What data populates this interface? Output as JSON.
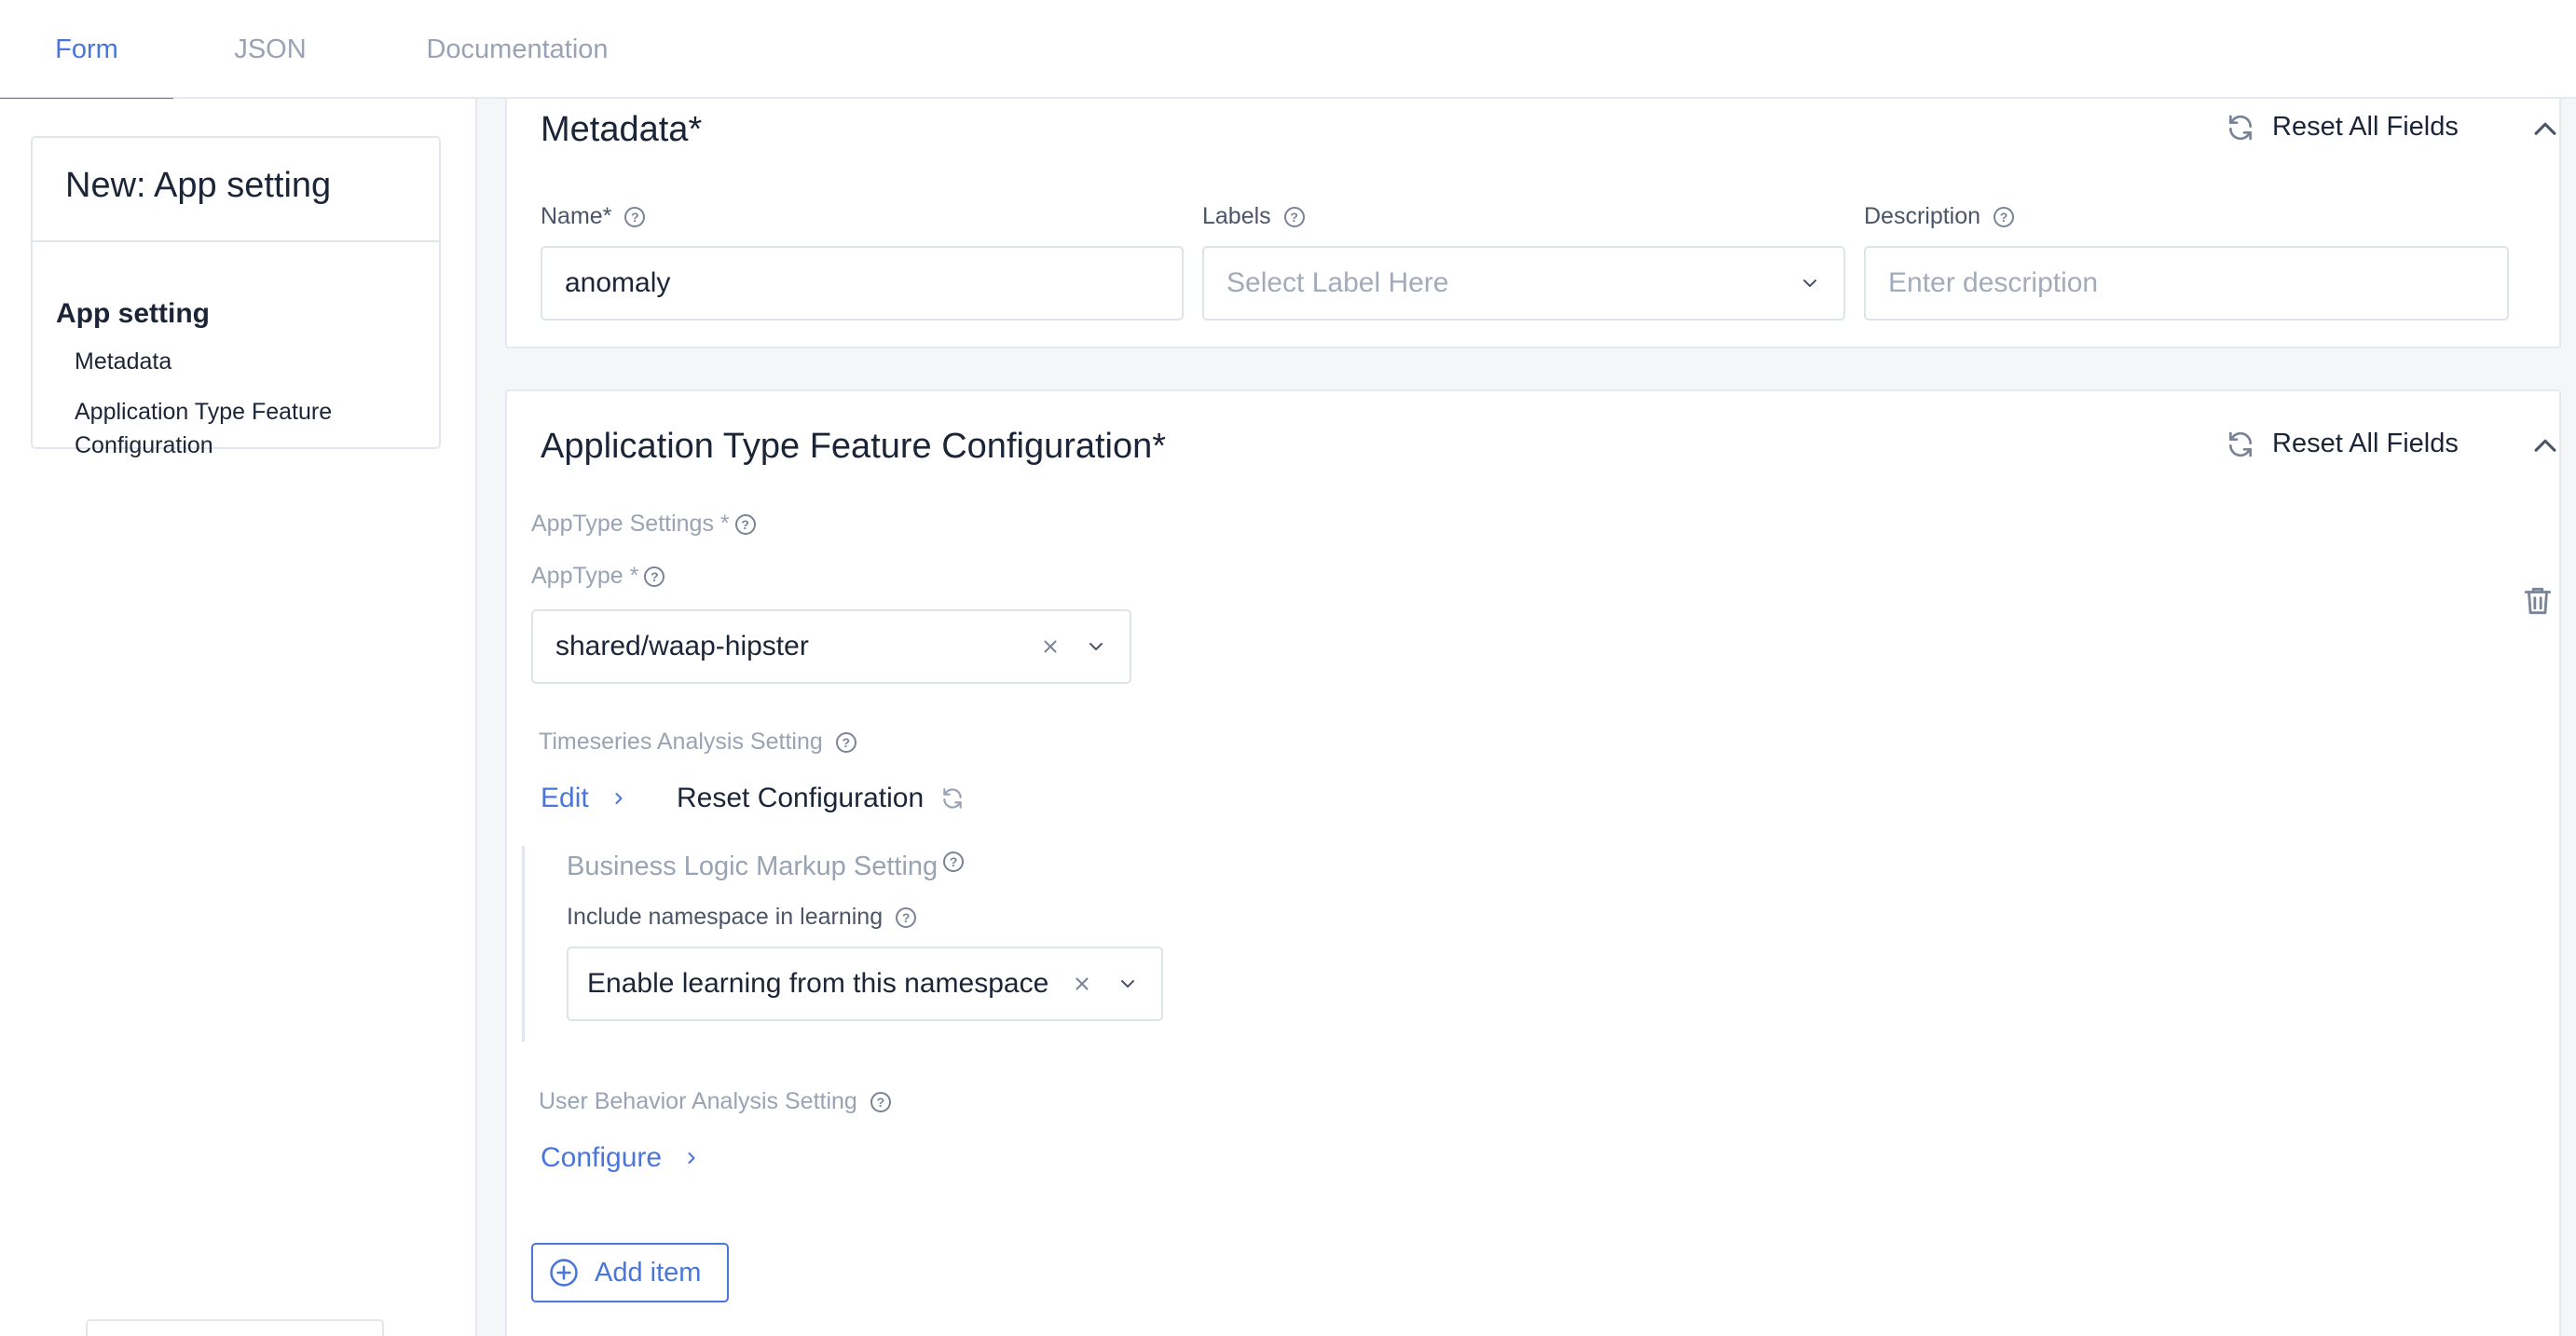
{
  "tabs": [
    {
      "label": "Form"
    },
    {
      "label": "JSON"
    },
    {
      "label": "Documentation"
    }
  ],
  "sidebar": {
    "title": "New: App setting",
    "section": "App setting",
    "items": [
      {
        "label": "Metadata"
      },
      {
        "label": "Application Type Feature Configuration"
      }
    ]
  },
  "metadata": {
    "title": "Metadata",
    "required_mark": "*",
    "reset_label": "Reset All Fields",
    "name_label": "Name*",
    "name_value": "anomaly",
    "labels_label": "Labels",
    "labels_placeholder": "Select Label Here",
    "description_label": "Description",
    "description_placeholder": "Enter description"
  },
  "app_config": {
    "title": "Application Type Feature Configuration",
    "required_mark": "*",
    "reset_label": "Reset All Fields",
    "apptype_settings_label": "AppType Settings *",
    "apptype_label": "AppType *",
    "apptype_value": "shared/waap-hipster",
    "timeseries_label": "Timeseries Analysis Setting",
    "edit_label": "Edit",
    "reset_configuration_label": "Reset Configuration",
    "business_logic_label": "Business Logic Markup Setting",
    "include_namespace_label": "Include namespace in learning",
    "include_namespace_value": "Enable learning from this namespace",
    "user_behavior_label": "User Behavior Analysis Setting",
    "configure_label": "Configure",
    "add_item_label": "Add item"
  },
  "colors": {
    "accent": "#4a76dc",
    "text": "#1c2537",
    "muted": "#9aa3b4",
    "border": "#e6e9ef",
    "background": "#f5f6f8"
  }
}
